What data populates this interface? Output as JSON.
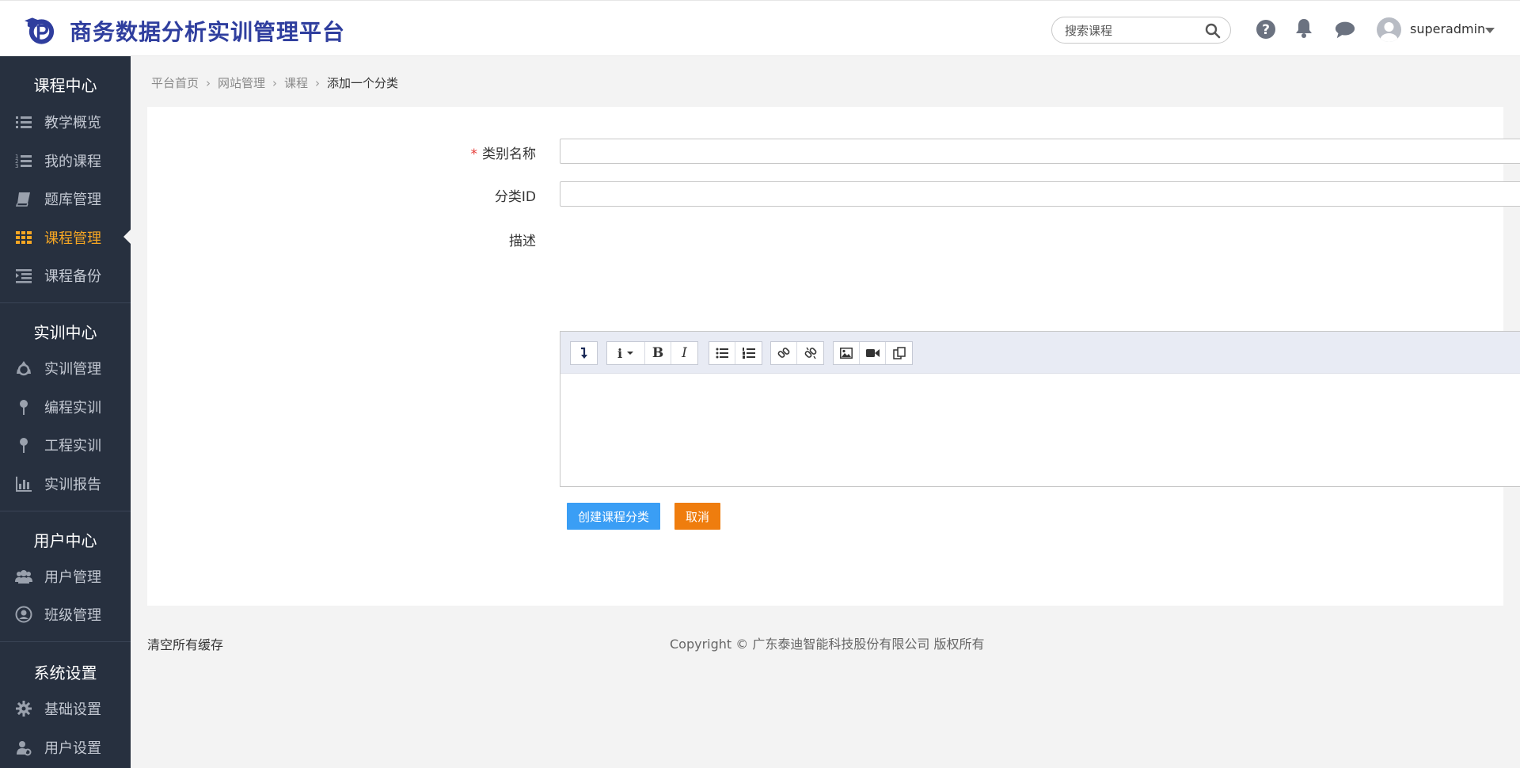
{
  "header": {
    "app_title": "商务数据分析实训管理平台",
    "search_placeholder": "搜索课程",
    "username": "superadmin"
  },
  "sidebar": {
    "sections": [
      {
        "title": "课程中心",
        "items": [
          {
            "label": "教学概览",
            "icon": "list-icon"
          },
          {
            "label": "我的课程",
            "icon": "numbered-list-icon"
          },
          {
            "label": "题库管理",
            "icon": "book-icon"
          },
          {
            "label": "课程管理",
            "icon": "grid-icon",
            "active": true
          },
          {
            "label": "课程备份",
            "icon": "indent-icon"
          }
        ]
      },
      {
        "title": "实训中心",
        "items": [
          {
            "label": "实训管理",
            "icon": "recycle-icon"
          },
          {
            "label": "编程实训",
            "icon": "pin-icon"
          },
          {
            "label": "工程实训",
            "icon": "pin-icon"
          },
          {
            "label": "实训报告",
            "icon": "bar-chart-icon"
          }
        ]
      },
      {
        "title": "用户中心",
        "items": [
          {
            "label": "用户管理",
            "icon": "users-icon"
          },
          {
            "label": "班级管理",
            "icon": "user-circle-icon"
          }
        ]
      },
      {
        "title": "系统设置",
        "items": [
          {
            "label": "基础设置",
            "icon": "gear-icon"
          },
          {
            "label": "用户设置",
            "icon": "user-cog-icon"
          }
        ]
      }
    ]
  },
  "breadcrumb": [
    "平台首页",
    "网站管理",
    "课程",
    "添加一个分类"
  ],
  "form": {
    "name_label": "类别名称",
    "required_mark": "*",
    "name_value": "",
    "id_label": "分类ID",
    "id_value": "",
    "desc_label": "描述",
    "submit_label": "创建课程分类",
    "cancel_label": "取消"
  },
  "editor_toolbar": {
    "bold": "B",
    "italic": "I",
    "info": "i"
  },
  "footer": {
    "clear_cache": "清空所有缓存",
    "copyright": "Copyright © 广东泰迪智能科技股份有限公司 版权所有"
  },
  "colors": {
    "brand_title": "#2f3e9e",
    "sidebar_bg": "#27303f",
    "active_nav": "#f5a623",
    "primary_button": "#3a9ef5",
    "cancel_button": "#ef7d0e"
  }
}
